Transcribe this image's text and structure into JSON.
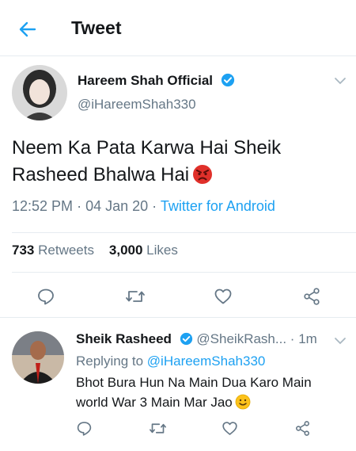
{
  "header": {
    "title": "Tweet"
  },
  "tweet": {
    "author_name": "Hareem Shah Official",
    "author_handle": "@iHareemShah330",
    "text": "Neem Ka Pata Karwa Hai Sheik Rasheed Bhalwa Hai",
    "emoji": "angry-face-icon",
    "time": "12:52 PM",
    "date": "04 Jan 20",
    "source": "Twitter for Android",
    "retweets_count": "733",
    "retweets_label": "Retweets",
    "likes_count": "3,000",
    "likes_label": "Likes"
  },
  "reply": {
    "author_name": "Sheik Rasheed",
    "author_handle": "@SheikRash...",
    "time": "1m",
    "replying_label": "Replying to",
    "replying_to": "@iHareemShah330",
    "text": "Bhot Bura Hun Na Main Dua Karo Main world War 3 Main Mar Jao",
    "emoji": "slightly-smiling-face-icon"
  },
  "colors": {
    "accent": "#1da1f2",
    "muted": "#657786",
    "text": "#14171a",
    "border": "#e6ecf0",
    "verified": "#1da1f2"
  }
}
